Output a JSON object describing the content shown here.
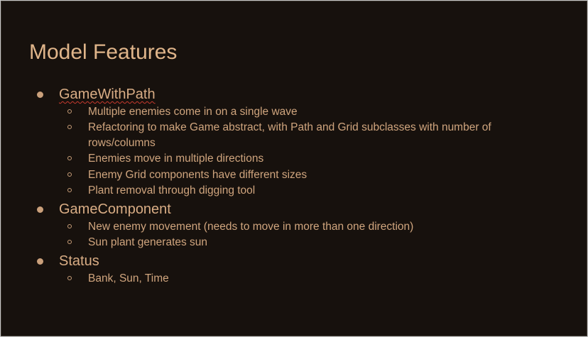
{
  "slide": {
    "title": "Model Features",
    "sections": [
      {
        "heading": "GameWithPath",
        "items": [
          "Multiple enemies come in on a single wave",
          "Refactoring to make Game abstract, with Path and Grid subclasses with number of rows/columns",
          "Enemies move in multiple directions",
          "Enemy Grid components have different sizes",
          "Plant removal through digging tool"
        ]
      },
      {
        "heading": "GameComponent",
        "items": [
          "New enemy movement (needs to move in more than one direction)",
          "Sun plant generates sun"
        ]
      },
      {
        "heading": "Status",
        "items": [
          "Bank, Sun, Time"
        ]
      }
    ]
  },
  "colors": {
    "background": "#17110d",
    "text": "#d5a982",
    "spellcheck": "#c83a2e"
  }
}
